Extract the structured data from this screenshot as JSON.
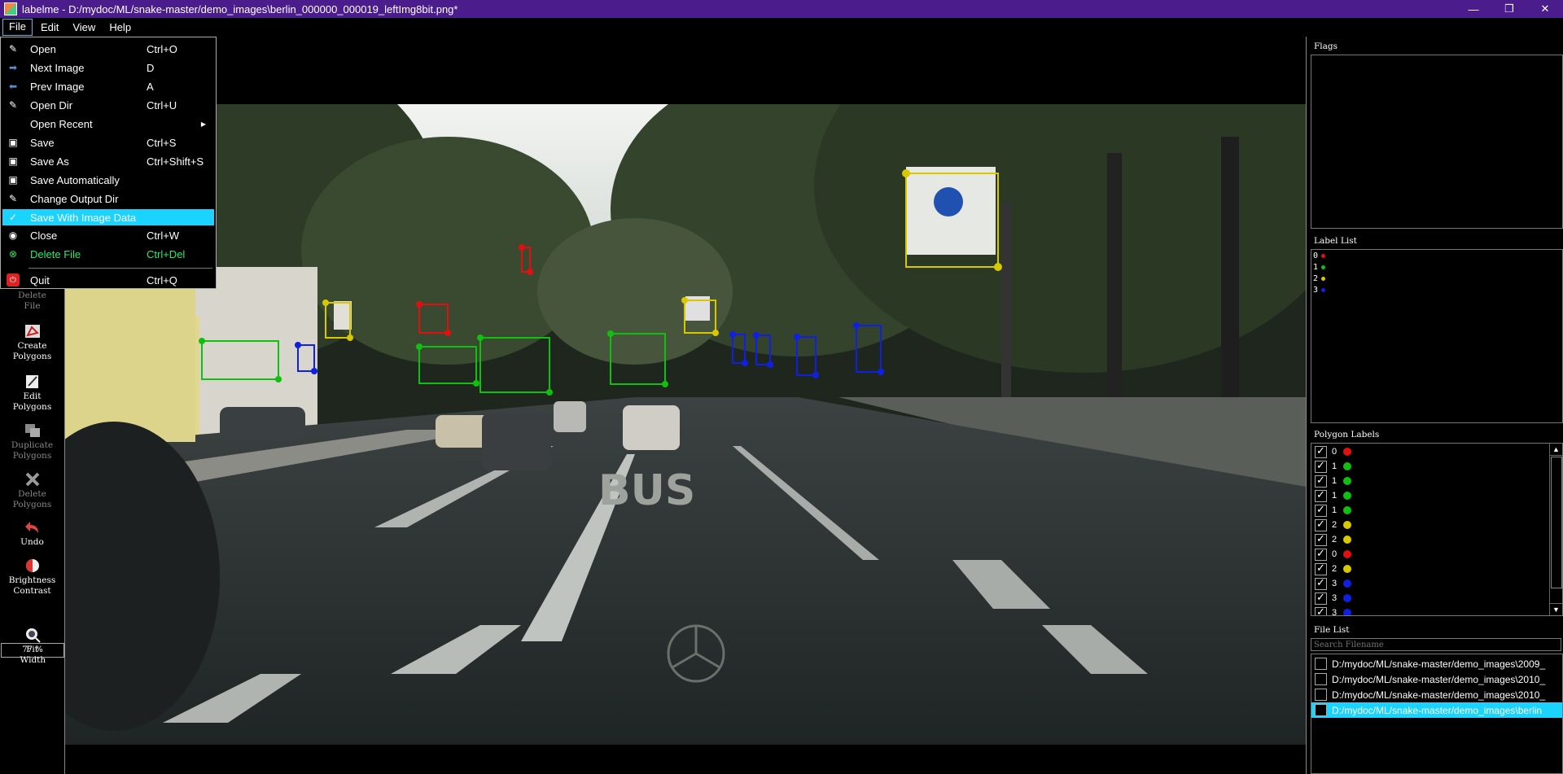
{
  "window": {
    "title": "labelme - D:/mydoc/ML/snake-master/demo_images\\berlin_000000_000019_leftImg8bit.png*",
    "minimize": "—",
    "restore": "❐",
    "close": "✕"
  },
  "menubar": {
    "items": [
      {
        "label": "File"
      },
      {
        "label": "Edit"
      },
      {
        "label": "View"
      },
      {
        "label": "Help"
      }
    ]
  },
  "file_menu": {
    "items": [
      {
        "label": "Open",
        "shortcut": "Ctrl+O",
        "icon": "open-icon"
      },
      {
        "label": "Next Image",
        "shortcut": "D",
        "icon": "next-icon"
      },
      {
        "label": "Prev Image",
        "shortcut": "A",
        "icon": "prev-icon"
      },
      {
        "label": "Open Dir",
        "shortcut": "Ctrl+U",
        "icon": "open-dir-icon"
      },
      {
        "label": "Open Recent",
        "shortcut": "",
        "icon": "submenu-arrow-icon"
      },
      {
        "label": "Save",
        "shortcut": "Ctrl+S",
        "icon": "save-icon"
      },
      {
        "label": "Save As",
        "shortcut": "Ctrl+Shift+S",
        "icon": "save-as-icon"
      },
      {
        "label": "Save Automatically",
        "shortcut": "",
        "icon": "save-auto-icon"
      },
      {
        "label": "Change Output Dir",
        "shortcut": "",
        "icon": "output-dir-icon"
      },
      {
        "label": "Save With Image Data",
        "shortcut": "",
        "icon": "checkmark-icon"
      },
      {
        "label": "Close",
        "shortcut": "Ctrl+W",
        "icon": "close-file-icon"
      },
      {
        "label": "Delete File",
        "shortcut": "Ctrl+Del",
        "icon": "delete-file-icon"
      },
      {
        "label": "Quit",
        "shortcut": "Ctrl+Q",
        "icon": "quit-icon"
      }
    ]
  },
  "toolbar": {
    "delete_file": "Delete File",
    "create_polygons": "Create Polygons",
    "edit_polygons": "Edit Polygons",
    "duplicate_polygons": "Duplicate Polygons",
    "delete_polygons": "Delete Polygons",
    "undo": "Undo",
    "brightness_contrast": "Brightness Contrast",
    "zoom": "77 %",
    "fit_width": "Fit Width"
  },
  "panels": {
    "flags_title": "Flags",
    "label_list_title": "Label List",
    "polygon_labels_title": "Polygon Labels",
    "file_list_title": "File List",
    "search_placeholder": "Search Filename"
  },
  "colors": {
    "0": "#e01010",
    "1": "#10c010",
    "2": "#d8c800",
    "3": "#1020e0"
  },
  "label_list": [
    {
      "label": "0",
      "color": "#e01010"
    },
    {
      "label": "1",
      "color": "#10c010"
    },
    {
      "label": "2",
      "color": "#d8c800"
    },
    {
      "label": "3",
      "color": "#1020e0"
    }
  ],
  "polygon_labels": [
    {
      "label": "0",
      "checked": true,
      "color": "#e01010"
    },
    {
      "label": "1",
      "checked": true,
      "color": "#10c010"
    },
    {
      "label": "1",
      "checked": true,
      "color": "#10c010"
    },
    {
      "label": "1",
      "checked": true,
      "color": "#10c010"
    },
    {
      "label": "1",
      "checked": true,
      "color": "#10c010"
    },
    {
      "label": "2",
      "checked": true,
      "color": "#d8c800"
    },
    {
      "label": "2",
      "checked": true,
      "color": "#d8c800"
    },
    {
      "label": "0",
      "checked": true,
      "color": "#e01010"
    },
    {
      "label": "2",
      "checked": true,
      "color": "#d8c800"
    },
    {
      "label": "3",
      "checked": true,
      "color": "#1020e0"
    },
    {
      "label": "3",
      "checked": true,
      "color": "#1020e0"
    },
    {
      "label": "3",
      "checked": true,
      "color": "#1020e0"
    }
  ],
  "file_list": [
    {
      "name": "D:/mydoc/ML/snake-master/demo_images\\2009_",
      "selected": false
    },
    {
      "name": "D:/mydoc/ML/snake-master/demo_images\\2010_",
      "selected": false
    },
    {
      "name": "D:/mydoc/ML/snake-master/demo_images\\2010_",
      "selected": false
    },
    {
      "name": "D:/mydoc/ML/snake-master/demo_images\\berlin",
      "selected": true
    }
  ],
  "scene": {
    "road_text": "BUS"
  }
}
